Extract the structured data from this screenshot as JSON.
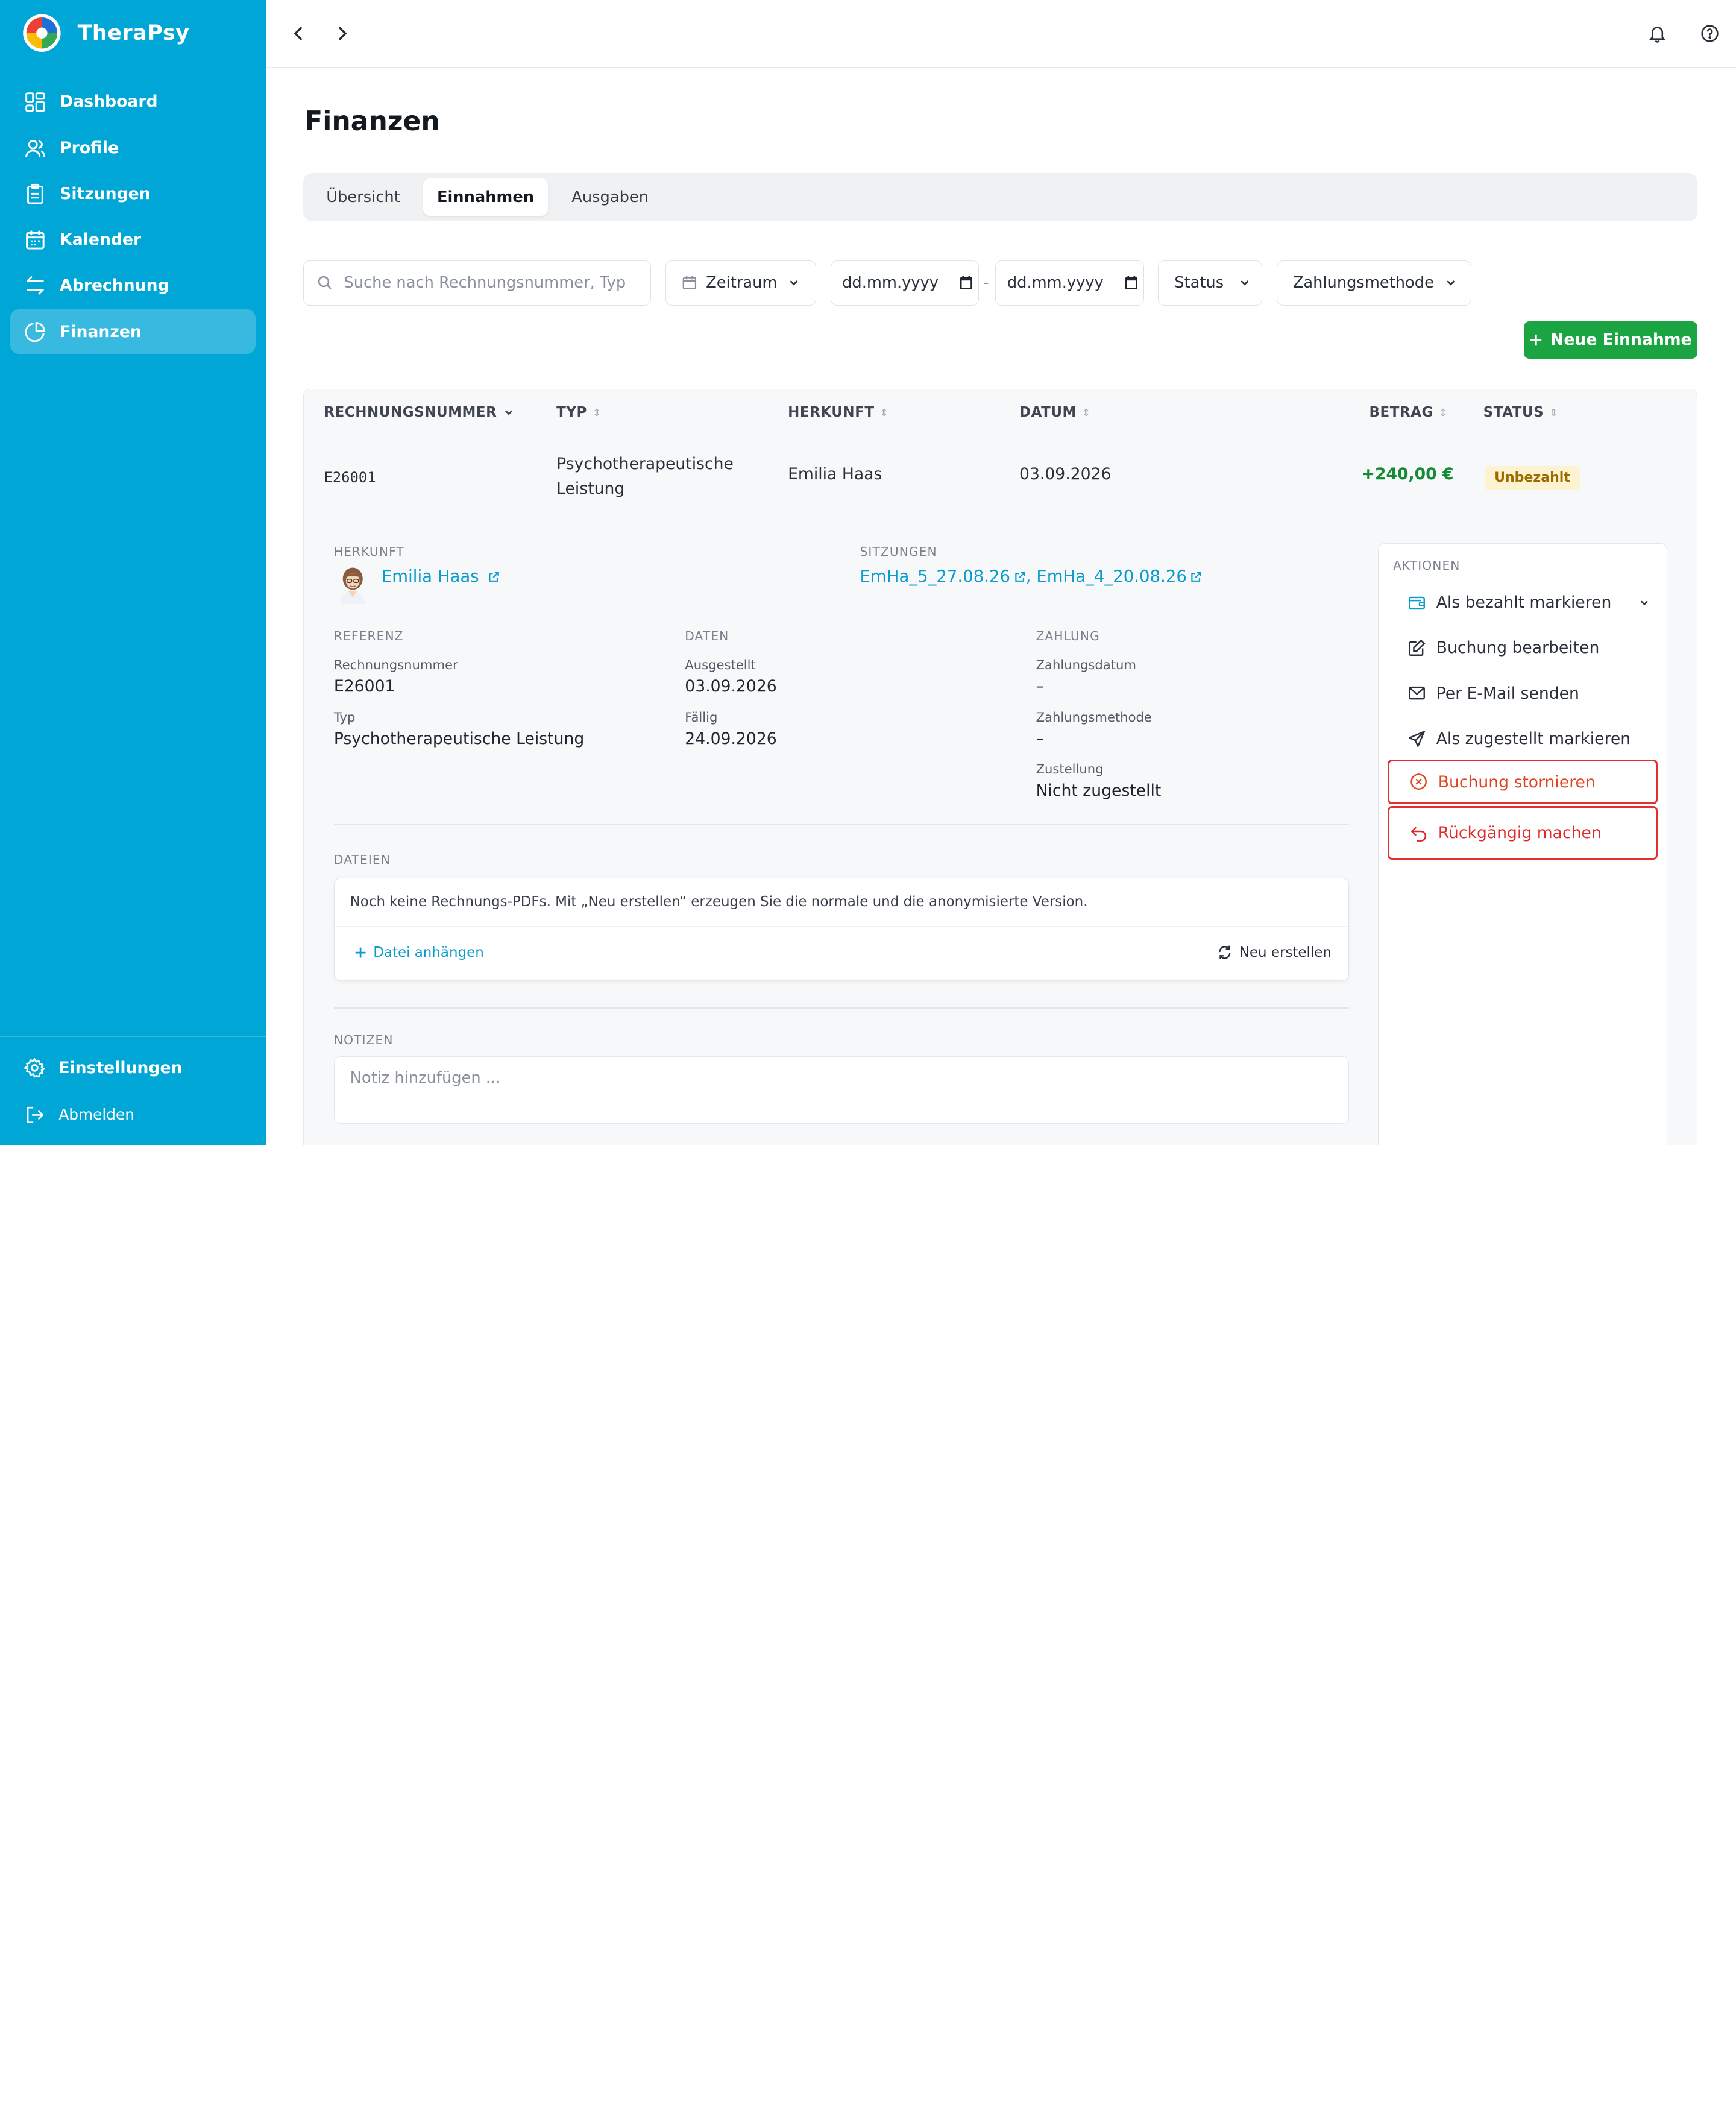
{
  "app": {
    "name": "TheraPsy"
  },
  "sidebar": {
    "items": [
      {
        "label": "Dashboard",
        "icon": "dashboard-icon"
      },
      {
        "label": "Profile",
        "icon": "users-icon"
      },
      {
        "label": "Sitzungen",
        "icon": "clipboard-icon"
      },
      {
        "label": "Kalender",
        "icon": "calendar-icon"
      },
      {
        "label": "Abrechnung",
        "icon": "swap-icon"
      },
      {
        "label": "Finanzen",
        "icon": "pie-chart-icon",
        "active": true
      }
    ],
    "settings": "Einstellungen",
    "logout": "Abmelden"
  },
  "page": {
    "title": "Finanzen"
  },
  "tabs": [
    "Übersicht",
    "Einnahmen",
    "Ausgaben"
  ],
  "filters": {
    "search_placeholder": "Suche nach Rechnungsnummer, Typ",
    "period": "Zeitraum",
    "date_from": "dd.mm.yyyy",
    "date_sep": "-",
    "date_to": "dd.mm.yyyy",
    "status": "Status",
    "payment_method": "Zahlungsmethode"
  },
  "new_button": "Neue Einnahme",
  "table": {
    "headers": [
      "RECHNUNGSNUMMER",
      "TYP",
      "HERKUNFT",
      "DATUM",
      "BETRAG",
      "STATUS"
    ],
    "row": {
      "number": "E26001",
      "type_line1": "Psychotherapeutische",
      "type_line2": "Leistung",
      "origin": "Emilia Haas",
      "date": "03.09.2026",
      "amount": "+240,00 €",
      "status": "Unbezahlt"
    }
  },
  "detail": {
    "herkunft_label": "HERKUNFT",
    "herkunft_name": "Emilia Haas",
    "sitzungen_label": "SITZUNGEN",
    "sitzung1": "EmHa_5_27.08.26",
    "sitzung_sep": ",",
    "sitzung2": "EmHa_4_20.08.26",
    "referenz_label": "REFERENZ",
    "rechnungsnummer_label": "Rechnungsnummer",
    "rechnungsnummer": "E26001",
    "typ_label": "Typ",
    "typ": "Psychotherapeutische Leistung",
    "daten_label": "DATEN",
    "ausgestellt_label": "Ausgestellt",
    "ausgestellt": "03.09.2026",
    "faellig_label": "Fällig",
    "faellig": "24.09.2026",
    "zahlung_label": "ZAHLUNG",
    "zahlungsdatum_label": "Zahlungsdatum",
    "zahlungsdatum": "–",
    "zahlungsmethode_label": "Zahlungsmethode",
    "zahlungsmethode": "–",
    "zustellung_label": "Zustellung",
    "zustellung": "Nicht zugestellt",
    "dateien_label": "DATEIEN",
    "files_note": "Noch keine Rechnungs-PDFs. Mit „Neu erstellen“ erzeugen Sie die normale und die anonymisierte Version.",
    "attach": "Datei anhängen",
    "regenerate": "Neu erstellen",
    "notizen_label": "NOTIZEN",
    "notes_placeholder": "Notiz hinzufügen ..."
  },
  "actions": {
    "title": "AKTIONEN",
    "mark_paid": "Als bezahlt markieren",
    "edit": "Buchung bearbeiten",
    "email": "Per E-Mail senden",
    "mark_delivered": "Als zugestellt markieren",
    "cancel": "Buchung stornieren",
    "undo": "Rückgängig machen"
  },
  "colors": {
    "sidebar": "#00a6d6",
    "primary_button": "#1aa542",
    "link": "#0a9ccb",
    "amount": "#178a37",
    "danger": "#e23030"
  }
}
